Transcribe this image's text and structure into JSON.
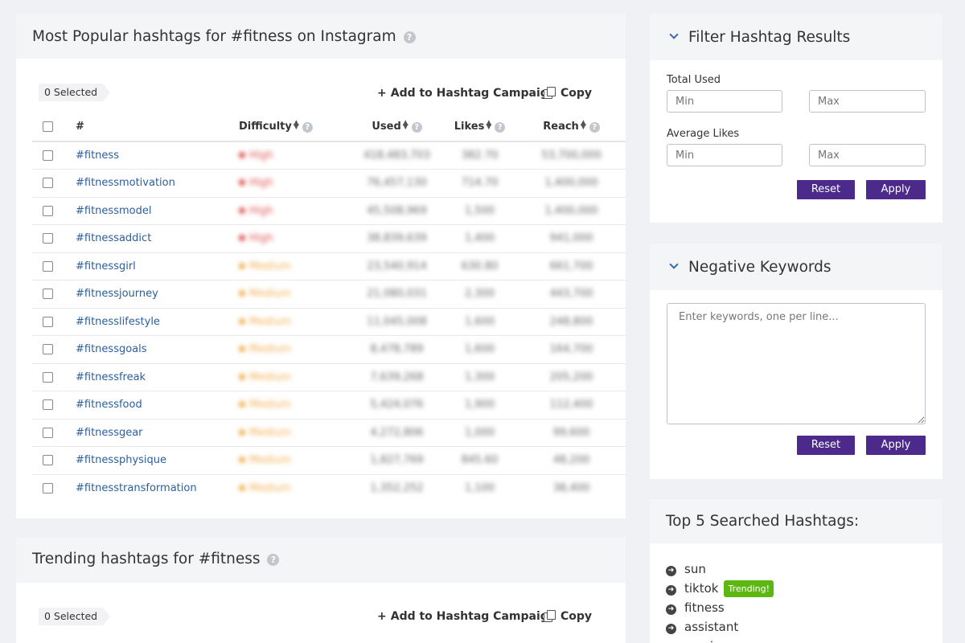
{
  "popular": {
    "title": "Most Popular hashtags for #fitness on Instagram",
    "selected": "0 Selected",
    "add_campaign": "Add to Hashtag Campaign",
    "copy": "Copy",
    "columns": {
      "tag": "#",
      "difficulty": "Difficulty",
      "used": "Used",
      "likes": "Likes",
      "reach": "Reach"
    },
    "rows": [
      {
        "tag": "#fitness",
        "difficulty": "High",
        "used": "418,483,703",
        "likes": "382.70",
        "reach": "53,700,000"
      },
      {
        "tag": "#fitnessmotivation",
        "difficulty": "High",
        "used": "76,457,130",
        "likes": "714.70",
        "reach": "1,400,000"
      },
      {
        "tag": "#fitnessmodel",
        "difficulty": "High",
        "used": "45,508,969",
        "likes": "1,500",
        "reach": "1,400,000"
      },
      {
        "tag": "#fitnessaddict",
        "difficulty": "High",
        "used": "38,839,639",
        "likes": "1,400",
        "reach": "941,000"
      },
      {
        "tag": "#fitnessgirl",
        "difficulty": "Medium",
        "used": "23,540,914",
        "likes": "630.80",
        "reach": "661,700"
      },
      {
        "tag": "#fitnessjourney",
        "difficulty": "Medium",
        "used": "21,080,031",
        "likes": "2,300",
        "reach": "443,700"
      },
      {
        "tag": "#fitnesslifestyle",
        "difficulty": "Medium",
        "used": "11,045,008",
        "likes": "1,600",
        "reach": "248,800"
      },
      {
        "tag": "#fitnessgoals",
        "difficulty": "Medium",
        "used": "8,478,789",
        "likes": "1,600",
        "reach": "164,700"
      },
      {
        "tag": "#fitnessfreak",
        "difficulty": "Medium",
        "used": "7,639,268",
        "likes": "1,300",
        "reach": "205,200"
      },
      {
        "tag": "#fitnessfood",
        "difficulty": "Medium",
        "used": "5,424,076",
        "likes": "1,900",
        "reach": "112,400"
      },
      {
        "tag": "#fitnessgear",
        "difficulty": "Medium",
        "used": "4,272,806",
        "likes": "1,000",
        "reach": "99,600"
      },
      {
        "tag": "#fitnessphysique",
        "difficulty": "Medium",
        "used": "1,827,769",
        "likes": "845.60",
        "reach": "48,200"
      },
      {
        "tag": "#fitnesstransformation",
        "difficulty": "Medium",
        "used": "1,352,252",
        "likes": "1,100",
        "reach": "38,400"
      }
    ]
  },
  "trending": {
    "title": "Trending hashtags for #fitness",
    "selected": "0 Selected",
    "add_campaign": "Add to Hashtag Campaign",
    "copy": "Copy"
  },
  "filter": {
    "title": "Filter Hashtag Results",
    "total_used_label": "Total Used",
    "average_likes_label": "Average Likes",
    "min_placeholder": "Min",
    "max_placeholder": "Max",
    "reset": "Reset",
    "apply": "Apply"
  },
  "negative": {
    "title": "Negative Keywords",
    "placeholder": "Enter keywords, one per line...",
    "reset": "Reset",
    "apply": "Apply"
  },
  "top5": {
    "title": "Top 5 Searched Hashtags:",
    "items": [
      "sun",
      "tiktok",
      "fitness",
      "assistant",
      "music"
    ],
    "trending_badge": "Trending!"
  },
  "colors": {
    "accent": "#4b2a8c",
    "link": "#2a5f9e",
    "high": "#d9534f",
    "medium": "#f0ad4e",
    "trending": "#5cb811"
  }
}
